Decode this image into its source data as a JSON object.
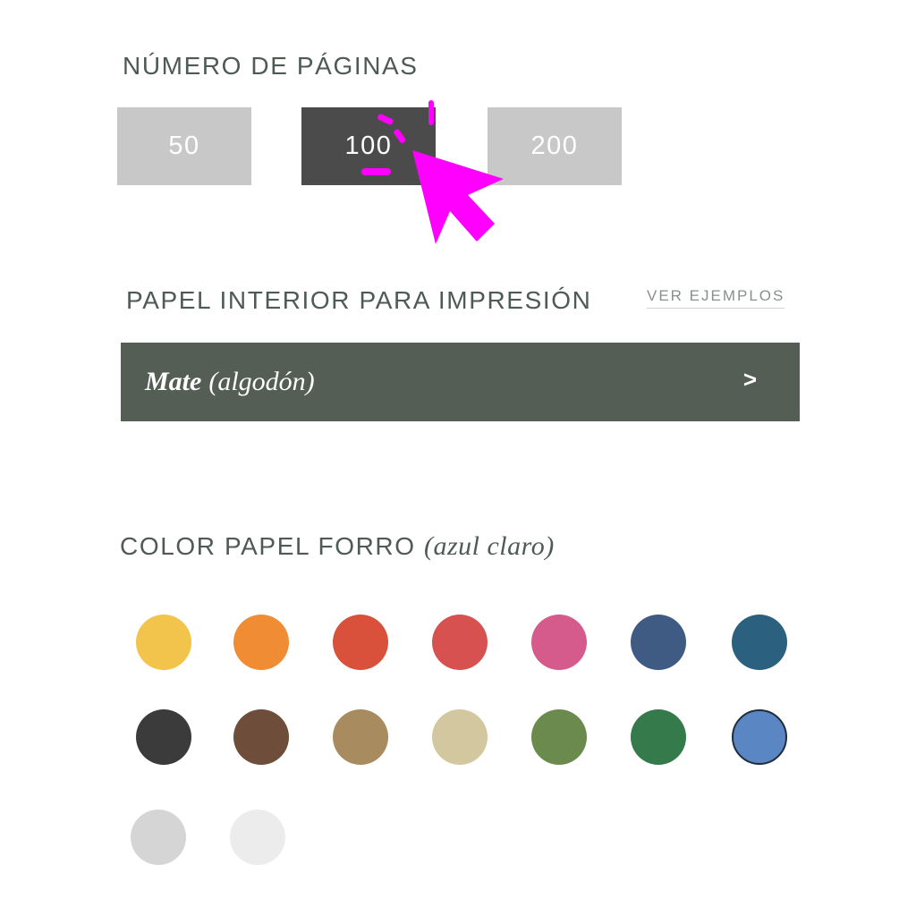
{
  "pages": {
    "heading": "NÚMERO DE PÁGINAS",
    "options": [
      {
        "label": "50",
        "selected": false
      },
      {
        "label": "100",
        "selected": true
      },
      {
        "label": "200",
        "selected": false
      }
    ]
  },
  "paper": {
    "heading": "PAPEL INTERIOR PARA IMPRESIÓN",
    "examples_link": "VER EJEMPLOS",
    "selected_name": "Mate",
    "selected_detail": "(algodón)",
    "arrow": ">"
  },
  "cover": {
    "heading": "COLOR PAPEL FORRO",
    "selected_color": "(azul claro)",
    "swatches": [
      "#f2c44b",
      "#ef8c34",
      "#d9513a",
      "#d6514f",
      "#d45b8c",
      "#3f5b83",
      "#2b607e",
      "#3b3b3b",
      "#6e4e3a",
      "#a98b60",
      "#d2c79e",
      "#6b8a4e",
      "#357a4b",
      "#5a86c4",
      "#d5d5d5",
      "#ececec"
    ],
    "selected_index": 13
  },
  "cursor": {
    "icon": "pointer-cursor-icon",
    "color": "#ff00ff"
  }
}
